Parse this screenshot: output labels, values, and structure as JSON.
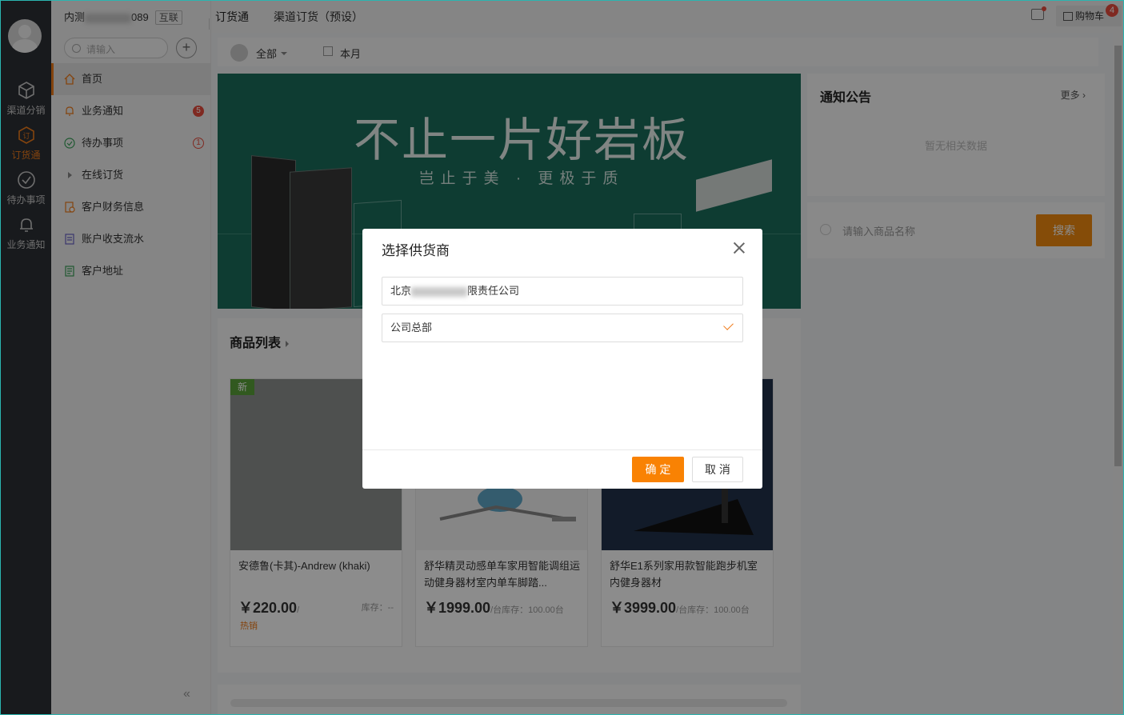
{
  "rail": {
    "items": [
      {
        "label": "渠道分销",
        "icon": "cube-icon"
      },
      {
        "label": "订货通",
        "icon": "order-icon",
        "active": true
      },
      {
        "label": "待办事项",
        "icon": "check-circle-icon"
      },
      {
        "label": "业务通知",
        "icon": "bell-icon"
      }
    ]
  },
  "sidebar": {
    "company_prefix": "内测",
    "company_suffix": "089",
    "company_tag": "互联",
    "search_placeholder": "请输入",
    "items": [
      {
        "label": "首页",
        "icon": "home-icon"
      },
      {
        "label": "业务通知",
        "icon": "bell-icon",
        "badge": "5"
      },
      {
        "label": "待办事项",
        "icon": "check-circle-icon",
        "badge": "1"
      },
      {
        "label": "在线订货",
        "icon": "caret-right-icon"
      },
      {
        "label": "客户财务信息",
        "icon": "finance-icon"
      },
      {
        "label": "账户收支流水",
        "icon": "ledger-icon"
      },
      {
        "label": "客户地址",
        "icon": "address-icon"
      }
    ],
    "collapse": "«"
  },
  "topbar": {
    "app_title": "订货通",
    "crumb": "渠道订货（预设）",
    "cart_label": "购物车",
    "cart_count": "4"
  },
  "filter": {
    "scope": "全部",
    "period": "本月"
  },
  "banner": {
    "title": "不止一片好岩板",
    "subtitle": "岂止于美 · 更极于质"
  },
  "notice": {
    "title": "通知公告",
    "more": "更多",
    "empty": "暂无相关数据"
  },
  "product_search": {
    "placeholder": "请输入商品名称",
    "button": "搜索"
  },
  "products": {
    "title": "商品列表",
    "items": [
      {
        "name": "安德鲁(卡其)-Andrew (khaki)",
        "price": "￥220.00",
        "unit": "/",
        "stock": "库存：--",
        "tag": "热销",
        "badge": "新"
      },
      {
        "name": "舒华精灵动感单车家用智能调组运动健身器材室内单车脚踏...",
        "price": "￥1999.00",
        "unit": "/台",
        "stock": "库存：100.00台"
      },
      {
        "name": "舒华E1系列家用款智能跑步机室内健身器材",
        "price": "￥3999.00",
        "unit": "/台",
        "stock": "库存：100.00台"
      }
    ]
  },
  "modal": {
    "title": "选择供货商",
    "options": [
      {
        "prefix": "北京",
        "suffix": "限责任公司",
        "selected": false
      },
      {
        "label": "公司总部",
        "selected": true
      }
    ],
    "ok": "确 定",
    "cancel": "取 消"
  },
  "colors": {
    "accent": "#f07c1b",
    "rail_bg": "#2d3035",
    "banner_bg": "#1b6e5c",
    "badge_red": "#e84c3d"
  }
}
